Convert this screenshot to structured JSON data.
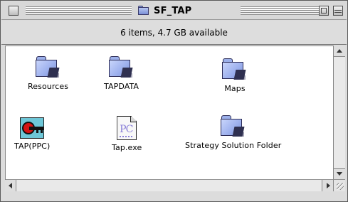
{
  "window": {
    "title": "SF_TAP",
    "title_icon": "folder-icon",
    "status": "6 items, 4.7 GB available"
  },
  "items": [
    {
      "label": "Resources",
      "icon": "folder-icon"
    },
    {
      "label": "TAPDATA",
      "icon": "folder-icon"
    },
    {
      "label": "Maps",
      "icon": "folder-icon"
    },
    {
      "label": "TAP(PPC)",
      "icon": "application-icon"
    },
    {
      "label": "Tap.exe",
      "icon": "document-icon",
      "doc_text": "PC"
    },
    {
      "label": "Strategy Solution Folder",
      "icon": "folder-icon"
    }
  ],
  "colors": {
    "folder": "#9fb2ee",
    "app_background": "#6ec7d8",
    "app_circle": "#d41414",
    "doc_text": "#8a7fd8"
  }
}
